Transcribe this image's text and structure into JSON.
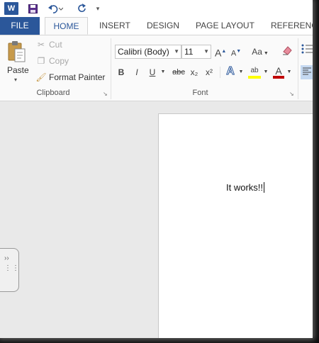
{
  "quick_access": {
    "app_logo_text": "W",
    "icons": [
      "save-icon",
      "undo-icon",
      "redo-icon",
      "customize-icon"
    ]
  },
  "tabs": [
    "FILE",
    "HOME",
    "INSERT",
    "DESIGN",
    "PAGE LAYOUT",
    "REFERENCE"
  ],
  "active_tab": "HOME",
  "clipboard": {
    "paste": "Paste",
    "cut": "Cut",
    "copy": "Copy",
    "format_painter": "Format Painter",
    "group_label": "Clipboard"
  },
  "font": {
    "font_name": "Calibri (Body)",
    "font_size": "11",
    "bold": "B",
    "italic": "I",
    "underline": "U",
    "strikethrough": "abc",
    "subscript": "x₂",
    "superscript": "x²",
    "grow": "A",
    "shrink": "A",
    "change_case": "Aa",
    "text_effects": "A",
    "highlight": "ab",
    "font_color": "A",
    "group_label": "Font",
    "colors": {
      "brand": "#2b579a",
      "highlight": "#ffff00",
      "font_color": "#c00000"
    }
  },
  "document": {
    "text": "It works!!"
  }
}
